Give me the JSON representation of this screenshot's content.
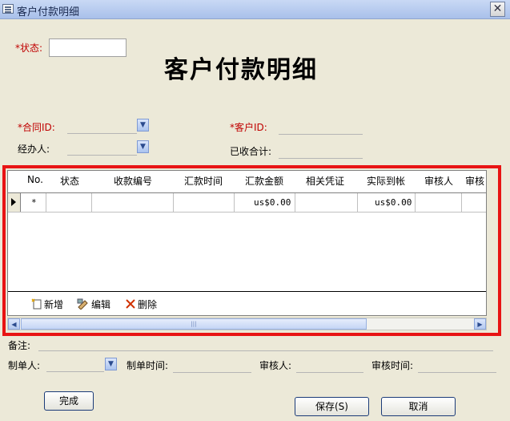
{
  "window": {
    "title": "客户付款明细",
    "close_glyph": "✕"
  },
  "form": {
    "status_label": "*状态:",
    "heading": "客户付款明细",
    "contract_id_label": "*合同ID:",
    "customer_id_label": "*客户ID:",
    "handler_label": "经办人:",
    "received_total_label": "已收合计:"
  },
  "grid": {
    "columns": [
      "No.",
      "状态",
      "收款编号",
      "汇款时间",
      "汇款金额",
      "相关凭证",
      "实际到帐",
      "审核人",
      "审核"
    ],
    "new_row": {
      "marker": "*",
      "remit_amount": "us$0.00",
      "actual_received": "us$0.00"
    },
    "toolbar": {
      "add": "新增",
      "edit": "编辑",
      "delete": "删除"
    }
  },
  "footer": {
    "remark_label": "备注:",
    "creator_label": "制单人:",
    "create_time_label": "制单时间:",
    "reviewer_label": "审核人:",
    "review_time_label": "审核时间:"
  },
  "buttons": {
    "done": "完成",
    "save": "保存(S)",
    "cancel": "取消"
  }
}
